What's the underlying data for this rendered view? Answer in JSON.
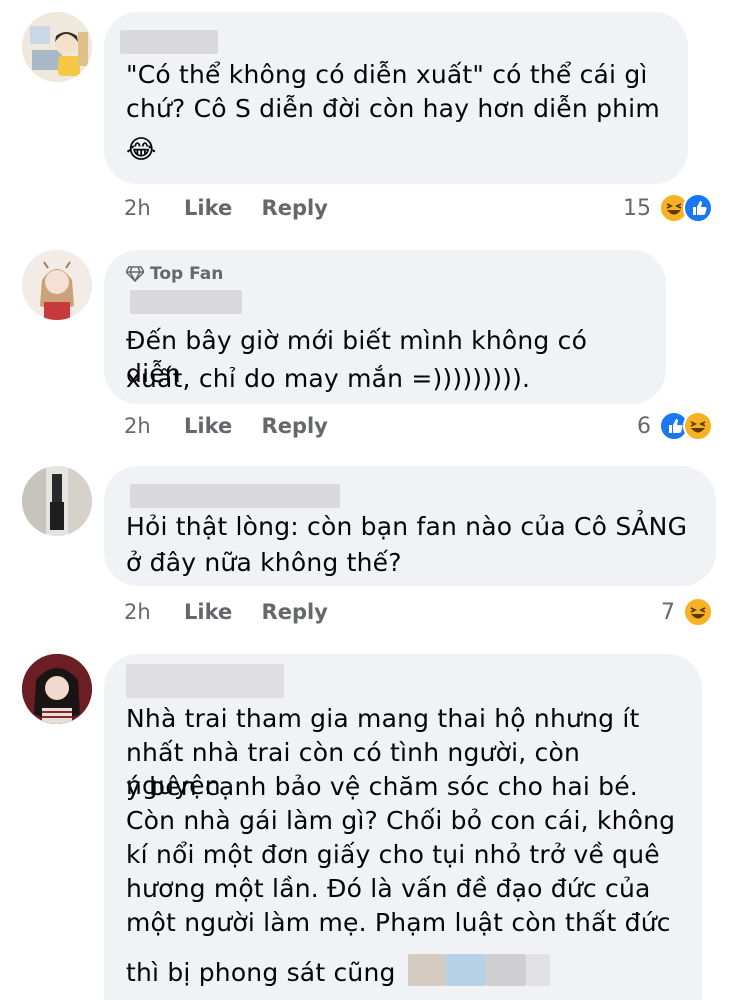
{
  "comments": [
    {
      "text_lines": [
        "\"Có thể không có diễn xuất\" có thể cái gì",
        "chứ? Cô S diễn đời còn hay hơn diễn phim"
      ],
      "emoji": "😂",
      "time": "2h",
      "like_label": "Like",
      "reply_label": "Reply",
      "reaction_count": "15",
      "reactions": [
        "haha",
        "like"
      ]
    },
    {
      "badge": "Top Fan",
      "text_lines": [
        "Đến bây giờ mới biết mình không có diễn",
        "xuất, chỉ do may mắn =)))))))))."
      ],
      "time": "2h",
      "like_label": "Like",
      "reply_label": "Reply",
      "reaction_count": "6",
      "reactions": [
        "like",
        "haha"
      ]
    },
    {
      "text_lines": [
        "Hỏi thật lòng: còn bạn fan nào của Cô SẢNG",
        "ở đây nữa không thế?"
      ],
      "time": "2h",
      "like_label": "Like",
      "reply_label": "Reply",
      "reaction_count": "7",
      "reactions": [
        "haha"
      ]
    },
    {
      "text_lines": [
        "Nhà trai tham gia mang thai hộ nhưng ít",
        "nhất nhà trai còn có tình người, còn nguyện",
        "ý bên cạnh bảo vệ chăm sóc cho hai bé.",
        "Còn nhà gái làm gì? Chối bỏ con cái, không",
        "kí nổi một đơn giấy cho tụi nhỏ trở về quê",
        "hương một lần. Đó là vấn đề đạo đức của",
        "một người làm mẹ. Phạm luật còn thất đức",
        "thì bị phong sát cũng"
      ]
    }
  ],
  "colors": {
    "bubble": "#f0f2f5",
    "meta_text": "#65676b",
    "like_blue": "#1877f2",
    "haha_yellow": "#f7b125"
  }
}
